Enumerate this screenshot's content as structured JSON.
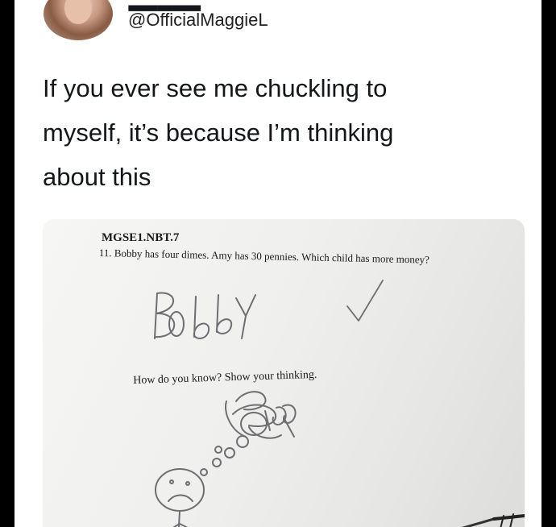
{
  "tweet": {
    "handle": "@OfficialMaggieL",
    "text_lines": [
      "If you ever see me chuckling to",
      "myself, it’s because I’m thinking",
      "about this"
    ]
  },
  "worksheet": {
    "standard_code": "MGSE1.NBT.7",
    "question": "11. Bobby has four dimes. Amy has 30 pennies. Which child has more money?",
    "answer_handwritten": "Bobby",
    "show_work_prompt": "How do you know? Show your thinking.",
    "work_handwritten": "Bobby"
  },
  "icons": {
    "check": "checkmark-icon",
    "sad_face": "sad-face-drawing"
  },
  "colors": {
    "tweet_bg": "#ffffff",
    "text": "#14171a",
    "pencil": "#6e6e72"
  }
}
